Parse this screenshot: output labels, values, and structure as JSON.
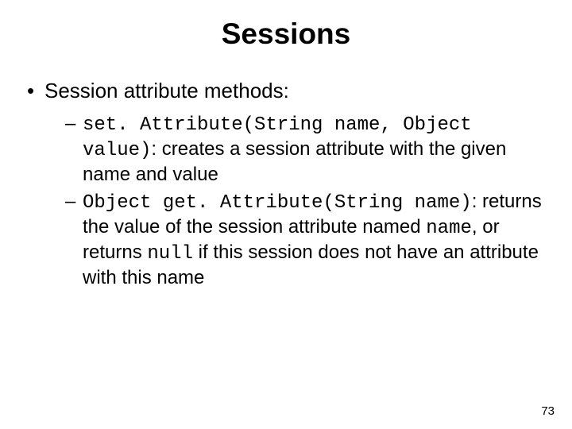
{
  "title": "Sessions",
  "level1": {
    "bullet": "•",
    "text": "Session attribute methods:"
  },
  "item1": {
    "dash": "–",
    "code_a": "set. Attribute(String name, Object ",
    "code_b": "value)",
    "desc": ": creates a session attribute with the given name and value"
  },
  "item2": {
    "dash": "–",
    "code_a": "Object get. Attribute(String name)",
    "desc_a": ": returns the value of the session attribute named ",
    "code_name": "name",
    "desc_b": ", or returns ",
    "code_null": "null",
    "desc_c": " if this session does not have an attribute with this name"
  },
  "page_number": "73"
}
